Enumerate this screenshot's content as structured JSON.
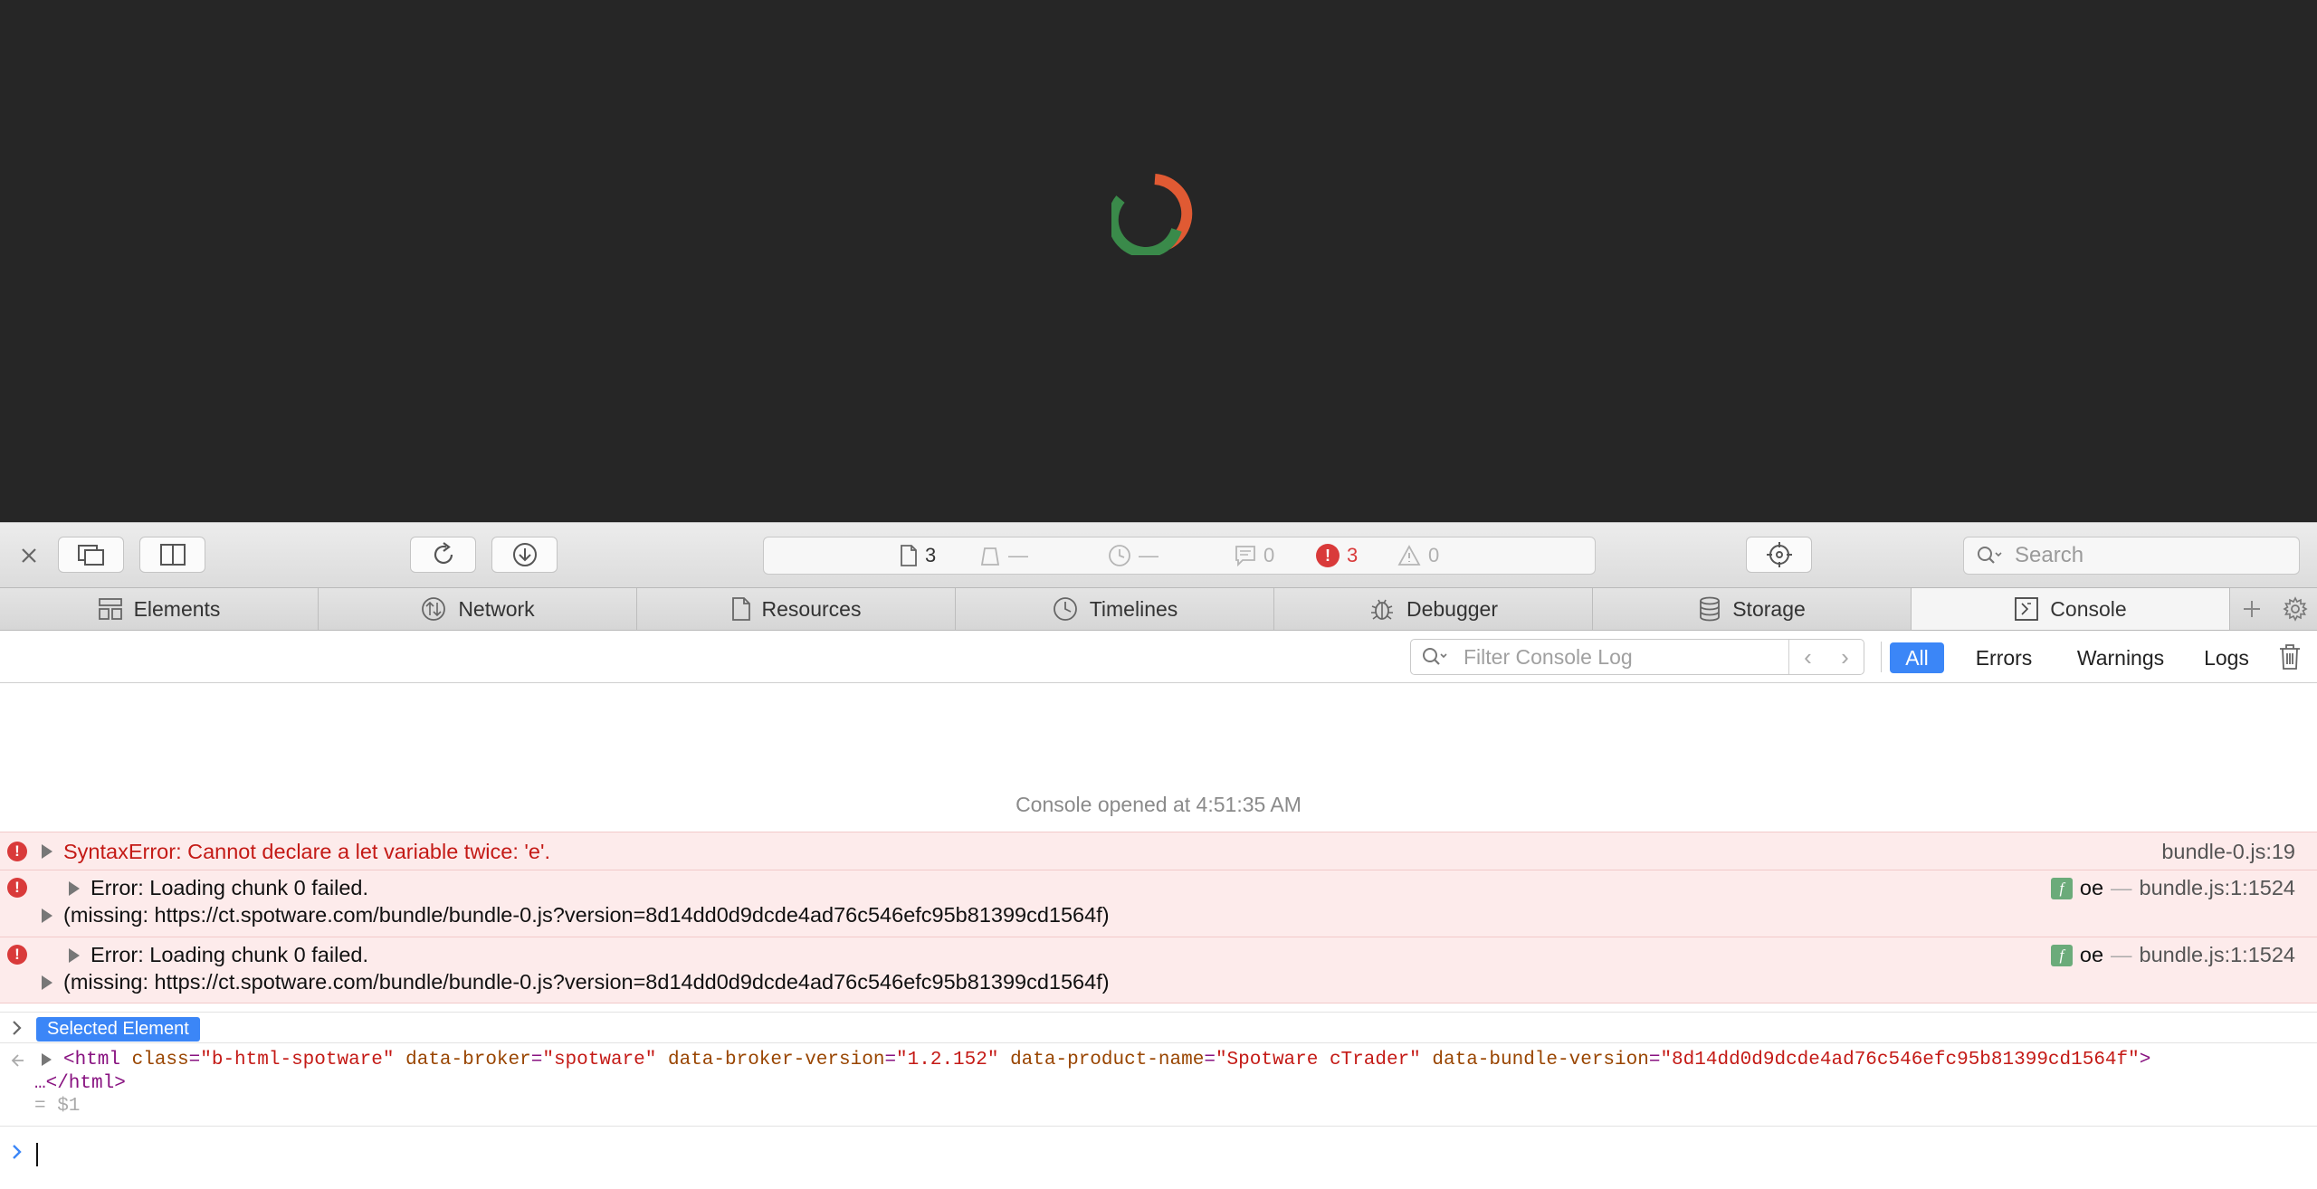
{
  "colors": {
    "accent": "#3b86f7",
    "error": "#d93a3a",
    "error_bg": "#fdebeb",
    "page_bg": "#262626",
    "spinner_orange": "#e05a33",
    "spinner_green": "#3a8a4a"
  },
  "toolbar": {
    "search_placeholder": "Search",
    "activity": {
      "resources_count": "3",
      "size_value": "—",
      "time_value": "—",
      "logs_count": "0",
      "errors_count": "3",
      "warnings_count": "0"
    }
  },
  "tabs": [
    {
      "label": "Elements",
      "icon": "elements-icon"
    },
    {
      "label": "Network",
      "icon": "network-icon"
    },
    {
      "label": "Resources",
      "icon": "resources-icon"
    },
    {
      "label": "Timelines",
      "icon": "timelines-icon"
    },
    {
      "label": "Debugger",
      "icon": "debugger-icon"
    },
    {
      "label": "Storage",
      "icon": "storage-icon"
    },
    {
      "label": "Console",
      "icon": "console-icon",
      "active": true
    }
  ],
  "filter": {
    "placeholder": "Filter Console Log",
    "scopes": [
      "All",
      "Errors",
      "Warnings",
      "Logs"
    ],
    "active_scope": "All"
  },
  "console": {
    "opened_message": "Console opened at 4:51:35 AM",
    "messages": [
      {
        "type": "error",
        "text": "SyntaxError: Cannot declare a let variable twice: 'e'.",
        "location": "bundle-0.js:19"
      },
      {
        "type": "error",
        "text": "Error: Loading chunk 0 failed.",
        "detail": "(missing: https://ct.spotware.com/bundle/bundle-0.js?version=8d14dd0d9dcde4ad76c546efc95b81399cd1564f)",
        "function": "oe",
        "location": "bundle.js:1:1524"
      },
      {
        "type": "error",
        "text": "Error: Loading chunk 0 failed.",
        "detail": "(missing: https://ct.spotware.com/bundle/bundle-0.js?version=8d14dd0d9dcde4ad76c546efc95b81399cd1564f)",
        "function": "oe",
        "location": "bundle.js:1:1524"
      }
    ],
    "selected_element_label": "Selected Element",
    "node": {
      "tag_open": "<html",
      "attrs": [
        {
          "name": "class",
          "value": "\"b-html-spotware\""
        },
        {
          "name": "data-broker",
          "value": "\"spotware\""
        },
        {
          "name": "data-broker-version",
          "value": "\"1.2.152\""
        },
        {
          "name": "data-product-name",
          "value": "\"Spotware cTrader\""
        },
        {
          "name": "data-bundle-version",
          "value": "\"8d14dd0d9dcde4ad76c546efc95b81399cd1564f\""
        }
      ],
      "tag_end": ">",
      "close_line": "…</html>",
      "result_ref": "= $1"
    },
    "prompt_value": ""
  }
}
